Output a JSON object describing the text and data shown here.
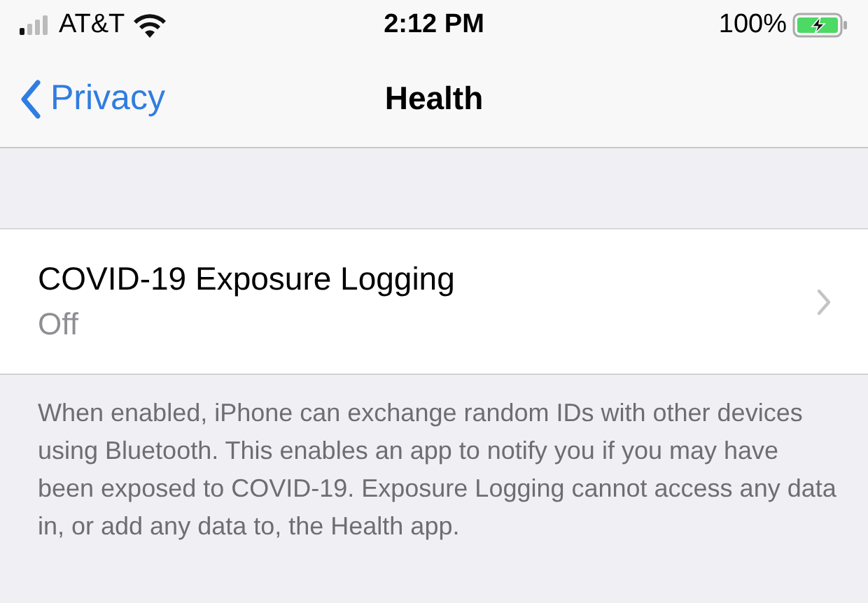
{
  "status_bar": {
    "carrier": "AT&T",
    "time": "2:12 PM",
    "battery": "100%"
  },
  "nav": {
    "back": "Privacy",
    "title": "Health"
  },
  "rows": [
    {
      "title": "COVID-19 Exposure Logging",
      "value": "Off"
    }
  ],
  "footer": "When enabled, iPhone can exchange random IDs with other devices using Bluetooth. This enables an app to notify you if you may have been exposed to COVID-19. Exposure Logging cannot access any data in, or add any data to, the Health app."
}
